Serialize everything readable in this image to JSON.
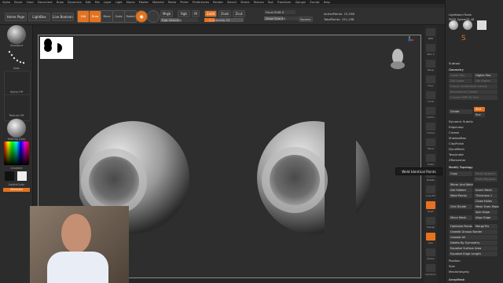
{
  "menubar": {
    "items": [
      "Alpha",
      "Brush",
      "Color",
      "Document",
      "Draw",
      "Dynamics",
      "Edit",
      "File",
      "Layer",
      "Light",
      "Macro",
      "Marker",
      "Material",
      "Movie",
      "Picker",
      "Preferences",
      "Render",
      "Stencil",
      "Stroke",
      "Texture",
      "Tool",
      "Transform",
      "Zplugin",
      "Zscript",
      "Help"
    ],
    "right": [
      "Close",
      "Make PolyMesh3D"
    ]
  },
  "toolbar": {
    "home_page": "Home Page",
    "lightbox": "LightBox",
    "live_boolean": "Live Boolean",
    "edit": "Edit",
    "draw": "Draw",
    "move": "Move",
    "scale": "Scale",
    "rotate": "Rotate",
    "mrgb": "Mrgb",
    "rgb": "Rgb",
    "m": "M",
    "zadd": "Zadd",
    "zsub": "Zsub",
    "zcut": "Zcut",
    "rgb_intensity": "Rgb Intensity",
    "z_intensity": "Z Intensity 25",
    "focal_shift": "Focal Shift 0",
    "draw_size": "Draw Size 64",
    "dynamic": "Dynamic",
    "active_points": "ActivePoints: 15,298",
    "total_points": "TotalPoints: 151,258"
  },
  "left_tray": {
    "brush_label": "Standard",
    "stroke_label": "Dots",
    "alpha_label": "Alpha Off",
    "texture_label": "Texture Off",
    "material_label": "MatCap Gray",
    "gradient_label": "Gradient",
    "switch_color": "SwitchColor",
    "alternate": "Alternate"
  },
  "shelf": {
    "buttons": [
      "BPR",
      "SPix 3",
      "Persp",
      "Floor",
      "Local",
      "Gizmo",
      "Frame",
      "Move",
      "Scale",
      "Rotate",
      "Line Fill",
      "PolyF",
      "Transp",
      "Solo",
      "Xpose",
      "Dynamic"
    ]
  },
  "right_tray": {
    "quick": [
      "Lightbox>Tools"
    ],
    "tool_name": "PM3D_Sphere3D_48",
    "subtool": "Subtool",
    "geometry": "Geometry",
    "items": [
      "Lower Res",
      "Higher Res",
      "Del Lower",
      "Del Higher",
      "Freeze SubDivision Levels",
      "Reconstruct Subdiv",
      "Convert BPR To Geo",
      "Divide",
      "Smt",
      "Suv",
      "Dynamic Subdiv",
      "EdgeLoop",
      "Crease",
      "ShadowBox",
      "ClayPolish",
      "DynaMesh",
      "Tessimate",
      "ZRemesher"
    ],
    "modify_topology": "Modify Topology",
    "topology_items": [
      "Copy",
      "Paste Append",
      "Paste Replace",
      "Mirror And Weld",
      "Del Hidden",
      "Insert Mesh",
      "Weld Points",
      "Spin Edge",
      "Close Holes",
      "Grid Divide",
      "Mesh From Mask",
      "Unweld Groups Border",
      "Micro Mesh",
      "Align Edge",
      "Optimize Points",
      "MergeTris",
      "Unweld All",
      "Delete By Symmetry",
      "Equalize Surface Area",
      "Equalize Edge Length",
      "Position",
      "Size",
      "MeshIntegrity",
      "ArrayMesh"
    ],
    "thickness": "Thickness 1"
  },
  "tooltip": "Weld Identical Points",
  "colors": {
    "accent": "#e4721f",
    "canvas": "#2e2e2e",
    "panel": "#2b2b2b"
  }
}
